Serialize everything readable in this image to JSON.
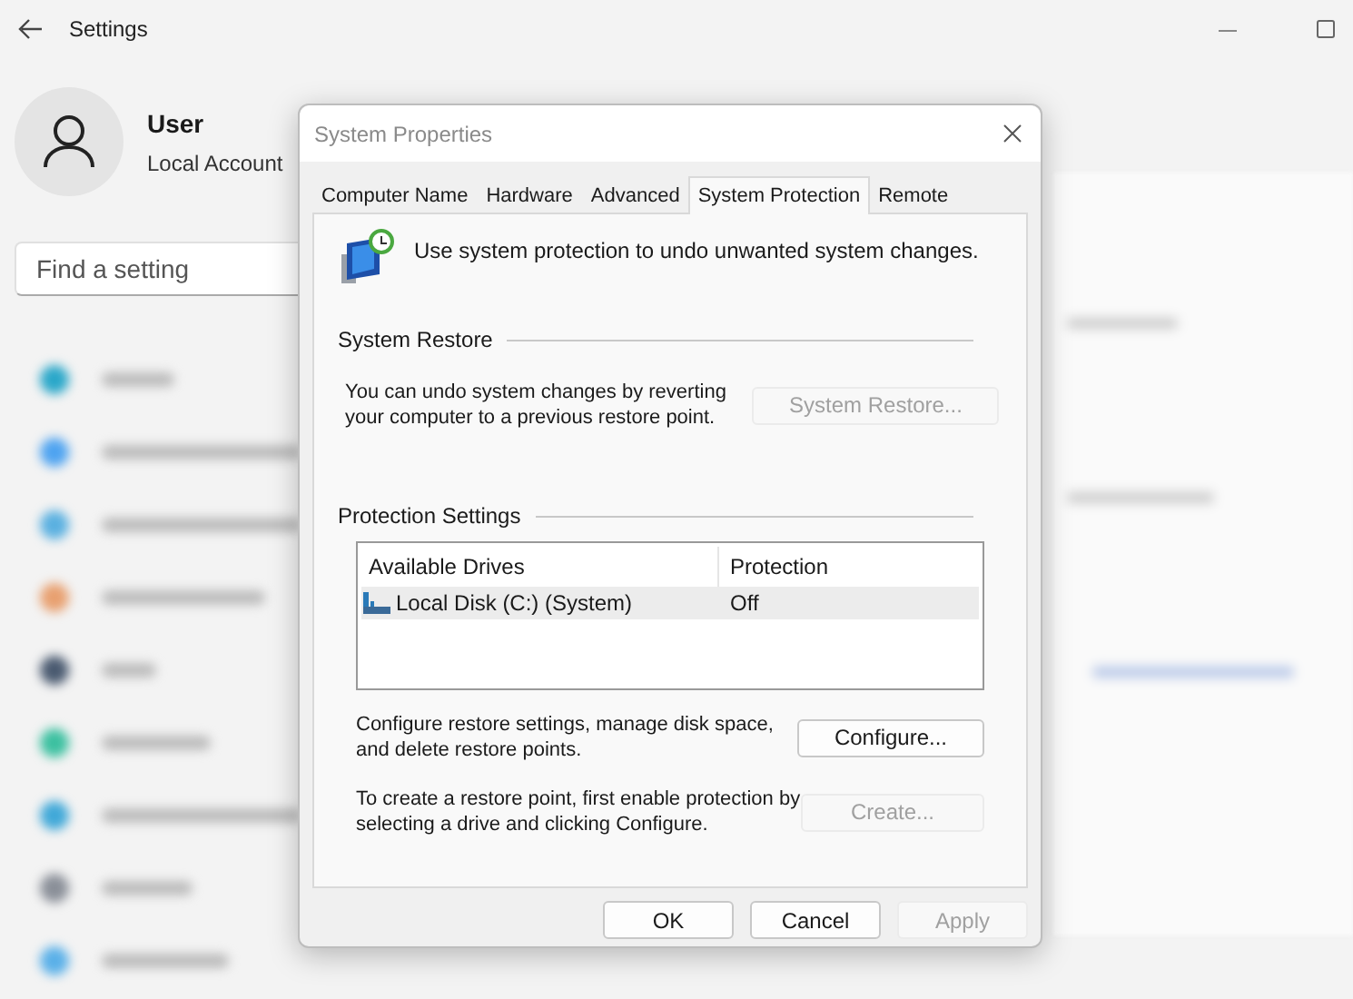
{
  "settings": {
    "title": "Settings",
    "user": {
      "name": "User",
      "account": "Local Account"
    },
    "search": {
      "placeholder": "Find a setting"
    }
  },
  "dialog": {
    "title": "System Properties",
    "tabs": [
      {
        "label": "Computer Name",
        "selected": false
      },
      {
        "label": "Hardware",
        "selected": false
      },
      {
        "label": "Advanced",
        "selected": false
      },
      {
        "label": "System Protection",
        "selected": true
      },
      {
        "label": "Remote",
        "selected": false
      }
    ],
    "intro": "Use system protection to undo unwanted system changes.",
    "system_restore": {
      "heading": "System Restore",
      "text": "You can undo system changes by reverting your computer to a previous restore point.",
      "button": {
        "label": "System Restore...",
        "disabled": true
      }
    },
    "protection_settings": {
      "heading": "Protection Settings",
      "columns": [
        "Available Drives",
        "Protection"
      ],
      "rows": [
        {
          "drive": "Local Disk (C:) (System)",
          "protection": "Off",
          "selected": true
        }
      ],
      "configure": {
        "text": "Configure restore settings, manage disk space, and delete restore points.",
        "button": {
          "label": "Configure...",
          "disabled": false
        }
      },
      "create": {
        "text": "To create a restore point, first enable protection by selecting a drive and clicking Configure.",
        "button": {
          "label": "Create...",
          "disabled": true
        }
      }
    },
    "buttons": [
      {
        "label": "OK",
        "disabled": false
      },
      {
        "label": "Cancel",
        "disabled": false
      },
      {
        "label": "Apply",
        "disabled": true
      }
    ]
  }
}
